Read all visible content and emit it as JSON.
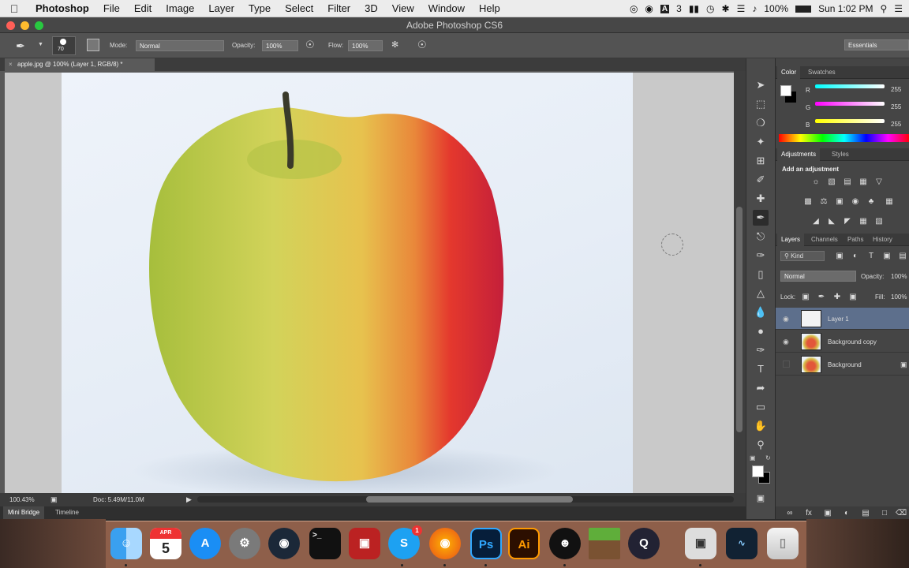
{
  "menubar": {
    "apple_icon": "apple-logo-icon",
    "items": [
      "Photoshop",
      "File",
      "Edit",
      "Image",
      "Layer",
      "Type",
      "Select",
      "Filter",
      "3D",
      "View",
      "Window",
      "Help"
    ],
    "status": {
      "badge_count": "3",
      "battery": "100%",
      "clock": "Sun 1:02 PM"
    }
  },
  "window": {
    "title": "Adobe Photoshop CS6"
  },
  "options": {
    "brush_size": "70",
    "mode_label": "Mode:",
    "mode_value": "Normal",
    "opacity_label": "Opacity:",
    "opacity_value": "100%",
    "flow_label": "Flow:",
    "flow_value": "100%",
    "workspace": "Essentials"
  },
  "document": {
    "tab_title": "apple.jpg @ 100% (Layer 1, RGB/8) *",
    "close_glyph": "×"
  },
  "status": {
    "zoom": "100.43%",
    "doc_size": "Doc: 5.49M/11.0M"
  },
  "bottom_tabs": [
    "Mini Bridge",
    "Timeline"
  ],
  "color_panel": {
    "tabs": [
      "Color",
      "Swatches"
    ],
    "channels": [
      {
        "label": "R",
        "value": "255",
        "color": "#ff3030"
      },
      {
        "label": "G",
        "value": "255",
        "color": "#e040e0"
      },
      {
        "label": "B",
        "value": "255",
        "color": "#f0f000"
      }
    ]
  },
  "adjustments_panel": {
    "tabs": [
      "Adjustments",
      "Styles"
    ],
    "heading": "Add an adjustment"
  },
  "layers_panel": {
    "tabs": [
      "Layers",
      "Channels",
      "Paths",
      "History"
    ],
    "kind_filter": "Kind",
    "blend_mode": "Normal",
    "opacity_label": "Opacity:",
    "opacity_value": "100%",
    "lock_label": "Lock:",
    "fill_label": "Fill:",
    "fill_value": "100%",
    "layers": [
      {
        "name": "Layer 1",
        "visible": true,
        "selected": true,
        "locked": false
      },
      {
        "name": "Background copy",
        "visible": true,
        "selected": false,
        "locked": false
      },
      {
        "name": "Background",
        "visible": false,
        "selected": false,
        "locked": true
      }
    ]
  },
  "dock": {
    "calendar": {
      "month": "APR",
      "day": "5"
    },
    "apps": [
      "finder-icon",
      "calendar-icon",
      "app-store-icon",
      "system-preferences-icon",
      "steam-icon",
      "terminal-icon",
      "photo-booth-icon",
      "skype-icon",
      "firefox-icon",
      "photoshop-icon",
      "illustrator-icon",
      "alpaca-app-icon",
      "minecraft-icon",
      "quicktime-icon",
      "preview-icon",
      "screen-recorder-icon",
      "trash-icon"
    ],
    "labels": {
      "photoshop": "Ps",
      "illustrator": "Ai",
      "skype": "S",
      "skype_badge": "1"
    }
  }
}
